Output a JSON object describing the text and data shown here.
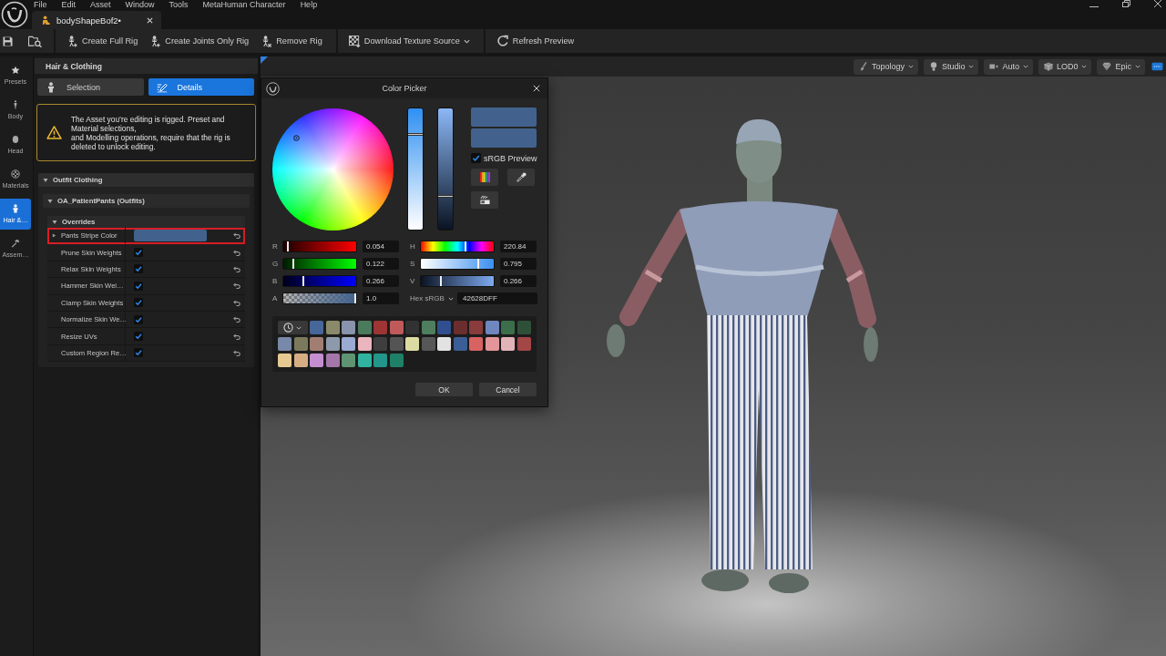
{
  "title_bar": {
    "menu": [
      "File",
      "Edit",
      "Asset",
      "Window",
      "Tools",
      "MetaHuman Character",
      "Help"
    ],
    "tab": {
      "label": "bodyShapeBof2•",
      "selected": true
    }
  },
  "toolbar": {
    "buttons": [
      {
        "label": "Create Full Rig",
        "dropdown": false
      },
      {
        "label": "Create Joints Only Rig",
        "dropdown": false
      },
      {
        "label": "Remove Rig",
        "dropdown": false
      },
      {
        "label": "Download Texture Source",
        "dropdown": true
      },
      {
        "label": "Refresh Preview",
        "dropdown": false
      }
    ]
  },
  "sidebar": {
    "items": [
      {
        "label": "Presets",
        "selected": false
      },
      {
        "label": "Body",
        "selected": false
      },
      {
        "label": "Head",
        "selected": false
      },
      {
        "label": "Materials",
        "selected": false
      },
      {
        "label": "Hair &…",
        "selected": true
      },
      {
        "label": "Assem…",
        "selected": false
      }
    ]
  },
  "panel": {
    "title": "Hair & Clothing",
    "tabs": [
      {
        "label": "Selection",
        "selected": false
      },
      {
        "label": "Details",
        "selected": true
      }
    ],
    "warning": {
      "lines": [
        "The Asset you’re editing is rigged. Preset and Material selections,",
        "and Modelling operations, require that the rig is deleted to unlock editing."
      ]
    },
    "section": {
      "title": "Outfit Clothing",
      "expanded": true,
      "item": {
        "title": "OA_PatientPants (Outfits)",
        "expanded": true,
        "group": {
          "title": "Overrides",
          "expanded": true,
          "rows": [
            {
              "kind": "color",
              "label": "Pants Stripe Color",
              "color": "#42628d",
              "expanded": false,
              "highlighted": true
            },
            {
              "kind": "checkbox",
              "label": "Prune Skin Weights",
              "checked": true,
              "highlighted": false
            },
            {
              "kind": "checkbox",
              "label": "Relax Skin Weights",
              "checked": true,
              "highlighted": false
            },
            {
              "kind": "checkbox",
              "label": "Hammer Skin Wei…",
              "checked": true,
              "highlighted": false
            },
            {
              "kind": "checkbox",
              "label": "Clamp Skin Weights",
              "checked": true,
              "highlighted": false
            },
            {
              "kind": "checkbox",
              "label": "Normalize Skin We…",
              "checked": true,
              "highlighted": false
            },
            {
              "kind": "checkbox",
              "label": "Resize UVs",
              "checked": true,
              "highlighted": false
            },
            {
              "kind": "checkbox",
              "label": "Custom Region Re…",
              "checked": true,
              "highlighted": false
            }
          ]
        }
      }
    }
  },
  "viewport": {
    "toolbar": [
      {
        "label": "Topology",
        "dropdown": true
      },
      {
        "label": "Studio",
        "dropdown": true
      },
      {
        "label": "Auto",
        "dropdown": true
      },
      {
        "label": "LOD0",
        "dropdown": true
      },
      {
        "label": "Epic",
        "dropdown": true
      }
    ]
  },
  "color_picker": {
    "title": "Color Picker",
    "vertical_sliders": [
      {
        "kind": "saturation",
        "level": 0.795
      },
      {
        "kind": "value",
        "level": 0.266
      }
    ],
    "swatches": [
      {
        "color": "#42628d"
      },
      {
        "color": "#42628d"
      }
    ],
    "srgb_preview": {
      "label": "sRGB Preview",
      "checked": true
    },
    "rgb": [
      {
        "kind": "red",
        "label": "R",
        "level": 0.054,
        "reading": "0.054"
      },
      {
        "kind": "green",
        "label": "G",
        "level": 0.122,
        "reading": "0.122"
      },
      {
        "kind": "blue",
        "label": "B",
        "level": 0.266,
        "reading": "0.266"
      },
      {
        "kind": "alpha",
        "label": "A",
        "level": 1.0,
        "reading": "1.0"
      }
    ],
    "hsv": [
      {
        "kind": "hue",
        "label": "H",
        "level": 0.613,
        "reading": "220.84"
      },
      {
        "kind": "saturation",
        "label": "S",
        "level": 0.795,
        "reading": "0.795"
      },
      {
        "kind": "value",
        "label": "V",
        "level": 0.266,
        "reading": "0.266"
      }
    ],
    "hex": {
      "mode": "Hex sRGB",
      "value": "42628DFF"
    },
    "palette": [
      {
        "color": "#47669a"
      },
      {
        "color": "#8a8a6a"
      },
      {
        "color": "#8893ac"
      },
      {
        "color": "#4b7a5c"
      },
      {
        "color": "#9e3434"
      },
      {
        "color": "#c05a5a"
      },
      {
        "color": "#323232"
      },
      {
        "color": "#4e7e5e"
      },
      {
        "color": "#2f4f8f"
      },
      {
        "color": "#6b2e2e"
      },
      {
        "color": "#8a3b3b"
      },
      {
        "color": "#6f86bf"
      },
      {
        "color": "#3c6e4c"
      },
      {
        "color": "#2f5038"
      },
      {
        "color": "#7888a8"
      },
      {
        "color": "#7c7a5c"
      },
      {
        "color": "#a27e72"
      },
      {
        "color": "#8e9aac"
      },
      {
        "color": "#9aaad2"
      },
      {
        "color": "#ebb5bd"
      },
      {
        "color": "#3e3e3e"
      },
      {
        "color": "#545454"
      },
      {
        "color": "#dcdca2"
      },
      {
        "color": "#575757"
      },
      {
        "color": "#e2e2e2"
      },
      {
        "color": "#3c5e96"
      },
      {
        "color": "#d96262"
      },
      {
        "color": "#e3959a"
      },
      {
        "color": "#e3b3ba"
      },
      {
        "color": "#a34646"
      },
      {
        "color": "#e6c992"
      },
      {
        "color": "#d6ae84"
      },
      {
        "color": "#c48ed0"
      },
      {
        "color": "#a476aa"
      },
      {
        "color": "#5e9472"
      },
      {
        "color": "#30b4a0"
      },
      {
        "color": "#22968a"
      },
      {
        "color": "#1f8068"
      }
    ],
    "buttons": [
      "OK",
      "Cancel"
    ]
  }
}
